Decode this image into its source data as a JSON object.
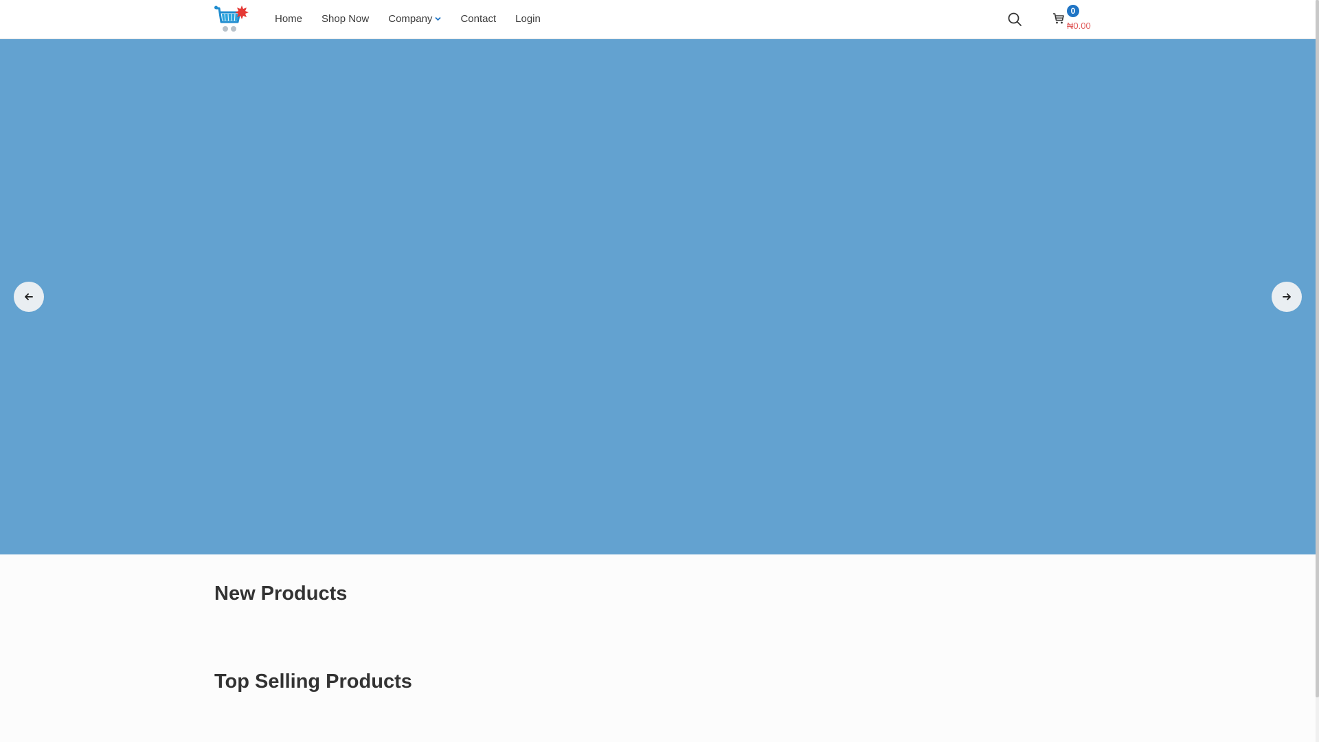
{
  "header": {
    "logo_icon": "shopping-cart-logo",
    "nav": [
      {
        "label": "Home"
      },
      {
        "label": "Shop Now"
      },
      {
        "label": "Company",
        "has_dropdown": true
      },
      {
        "label": "Contact"
      },
      {
        "label": "Login"
      }
    ],
    "search_icon": "search-icon",
    "cart": {
      "icon": "cart-icon",
      "count": "0",
      "total": "₦0.00"
    }
  },
  "hero": {
    "background_color": "#63a2d0",
    "prev_icon": "arrow-left-icon",
    "next_icon": "arrow-right-icon"
  },
  "sections": {
    "new_products_title": "New Products",
    "top_selling_title": "Top Selling Products"
  },
  "colors": {
    "accent": "#1f74c4",
    "price": "#e05a5a"
  }
}
